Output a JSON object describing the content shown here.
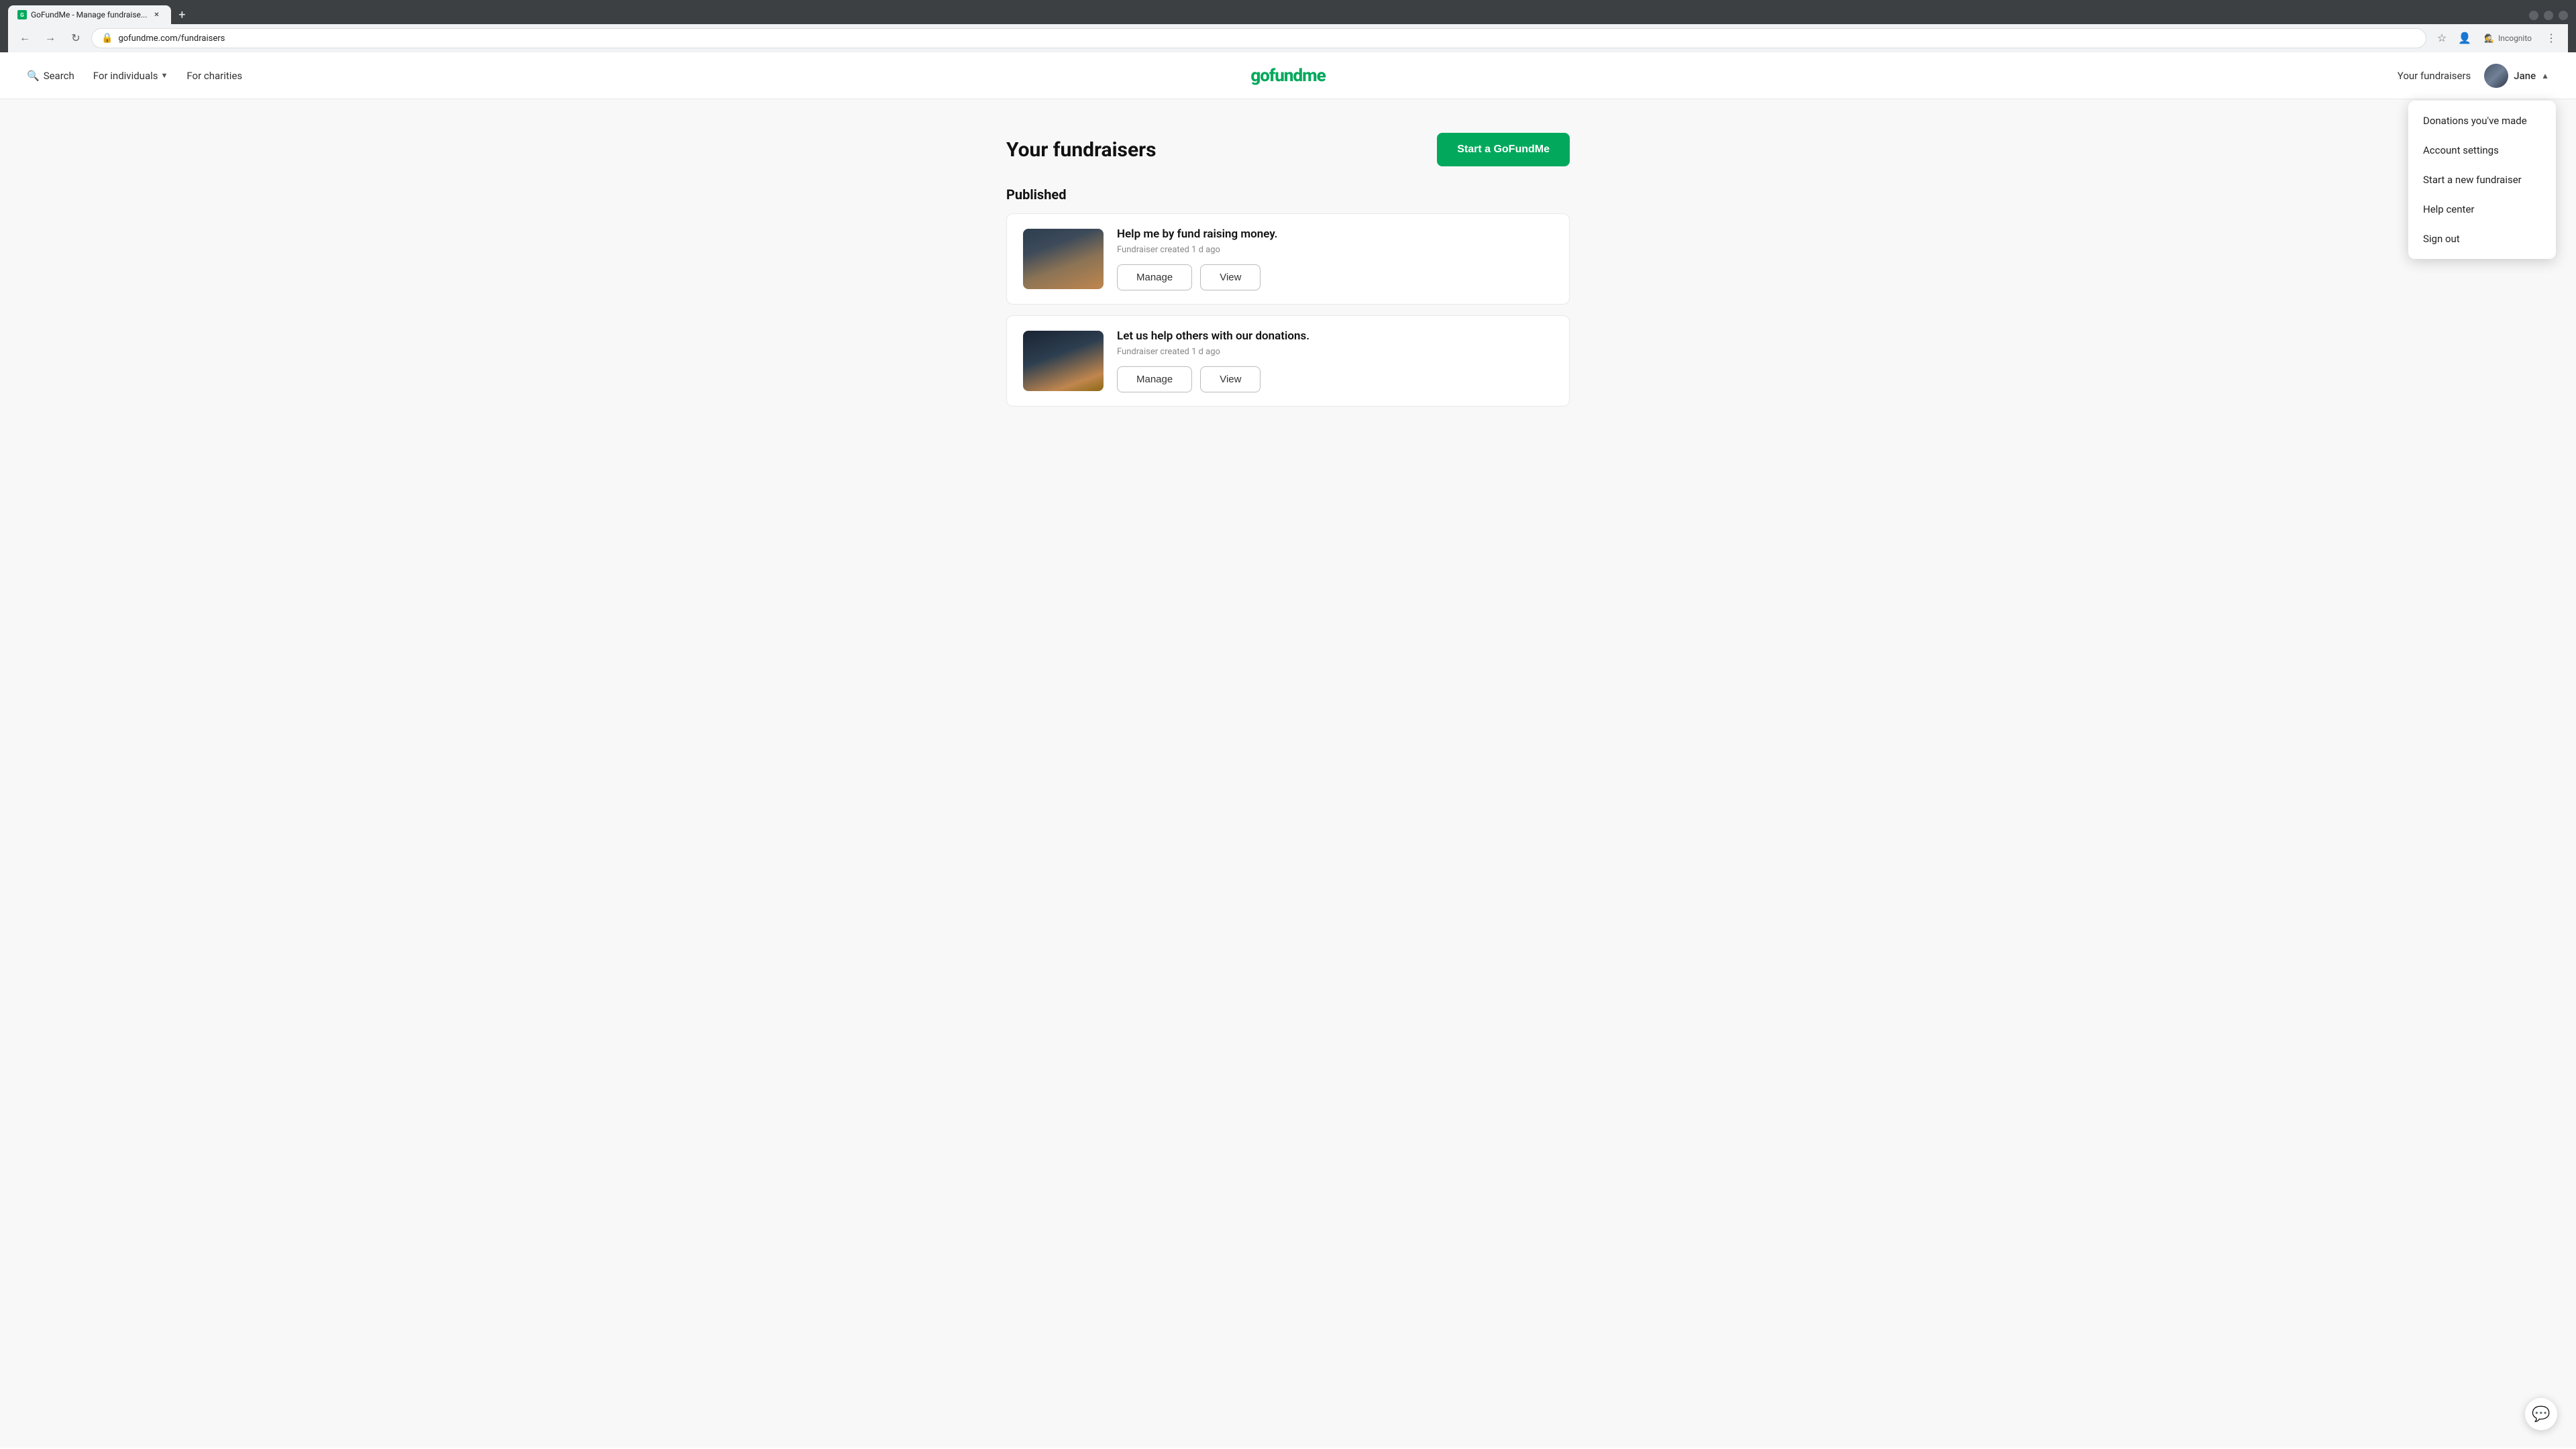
{
  "browser": {
    "tab_title": "GoFundMe - Manage fundraise...",
    "tab_favicon": "G",
    "url": "gofundme.com/fundraisers",
    "incognito_label": "Incognito"
  },
  "header": {
    "search_label": "Search",
    "for_individuals_label": "For individuals",
    "for_charities_label": "For charities",
    "logo_text": "gofundme",
    "your_fundraisers_label": "Your fundraisers",
    "user_name": "Jane",
    "chevron": "▲"
  },
  "dropdown": {
    "items": [
      {
        "id": "donations",
        "label": "Donations you've made"
      },
      {
        "id": "account",
        "label": "Account settings"
      },
      {
        "id": "new-fundraiser",
        "label": "Start a new fundraiser"
      },
      {
        "id": "help",
        "label": "Help center"
      },
      {
        "id": "signout",
        "label": "Sign out"
      }
    ]
  },
  "main": {
    "page_title": "Your fundraisers",
    "start_button_label": "Start a GoFundMe",
    "published_section_title": "Published",
    "fundraisers": [
      {
        "id": 1,
        "title": "Help me by fund raising money.",
        "meta": "Fundraiser created 1 d ago",
        "manage_label": "Manage",
        "view_label": "View"
      },
      {
        "id": 2,
        "title": "Let us help others with our donations.",
        "meta": "Fundraiser created 1 d ago",
        "manage_label": "Manage",
        "view_label": "View"
      }
    ]
  },
  "chat": {
    "icon": "💬"
  }
}
